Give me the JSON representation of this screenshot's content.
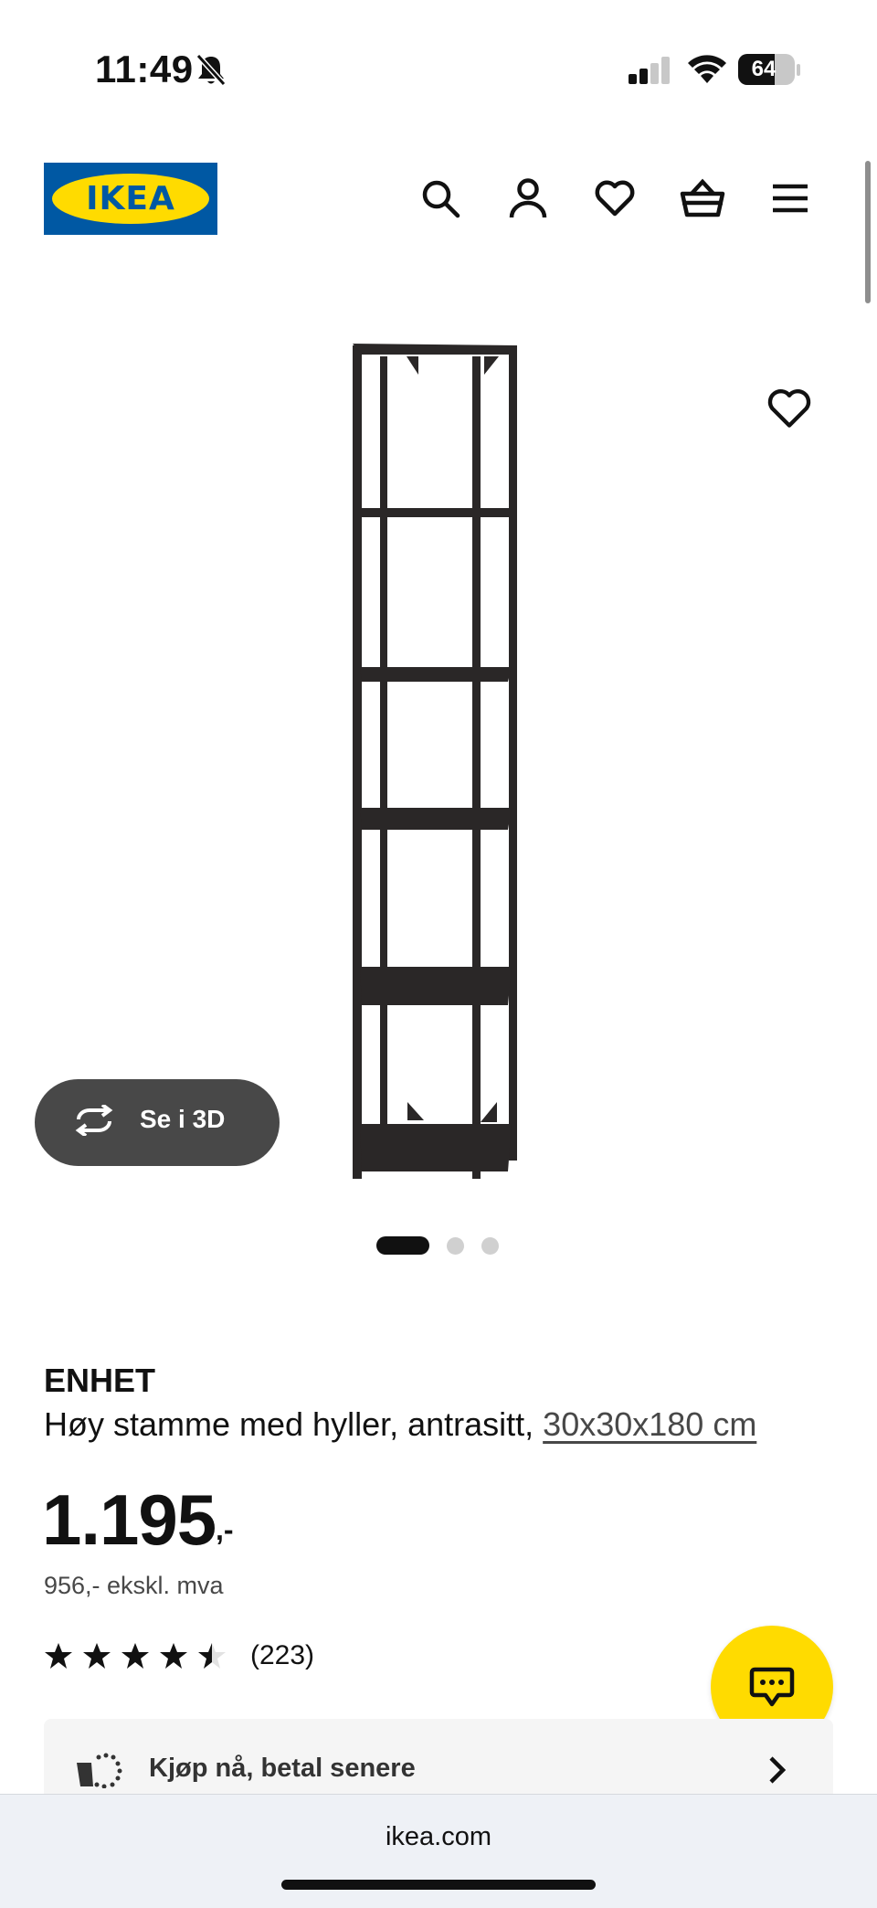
{
  "status_bar": {
    "time": "11:49",
    "battery_level": "64",
    "battery_fraction": 0.64,
    "icons": [
      "bell-slash-icon",
      "cellular-signal-icon",
      "wifi-icon",
      "battery-icon"
    ]
  },
  "header": {
    "logo_text": "IKEA",
    "icons": [
      "search-icon",
      "account-icon",
      "wishlist-icon",
      "basket-icon",
      "menu-icon"
    ],
    "brand_colors": {
      "blue": "#0058a3",
      "yellow": "#ffdb00"
    }
  },
  "gallery": {
    "view_3d_label": "Se i 3D",
    "current_slide": 1,
    "total_slides": 3
  },
  "product": {
    "name": "ENHET",
    "description": "Høy stamme med hyller, antrasitt,",
    "dimensions": "30x30x180 cm",
    "price_main": "1.195",
    "price_suffix": ",-",
    "price_ex_vat": "956,- ekskl. mva",
    "rating_value": 4.5,
    "rating_max": 5,
    "rating_count": "(223)"
  },
  "payment_option": {
    "label": "Kjøp nå, betal senere"
  },
  "browser": {
    "url": "ikea.com"
  }
}
